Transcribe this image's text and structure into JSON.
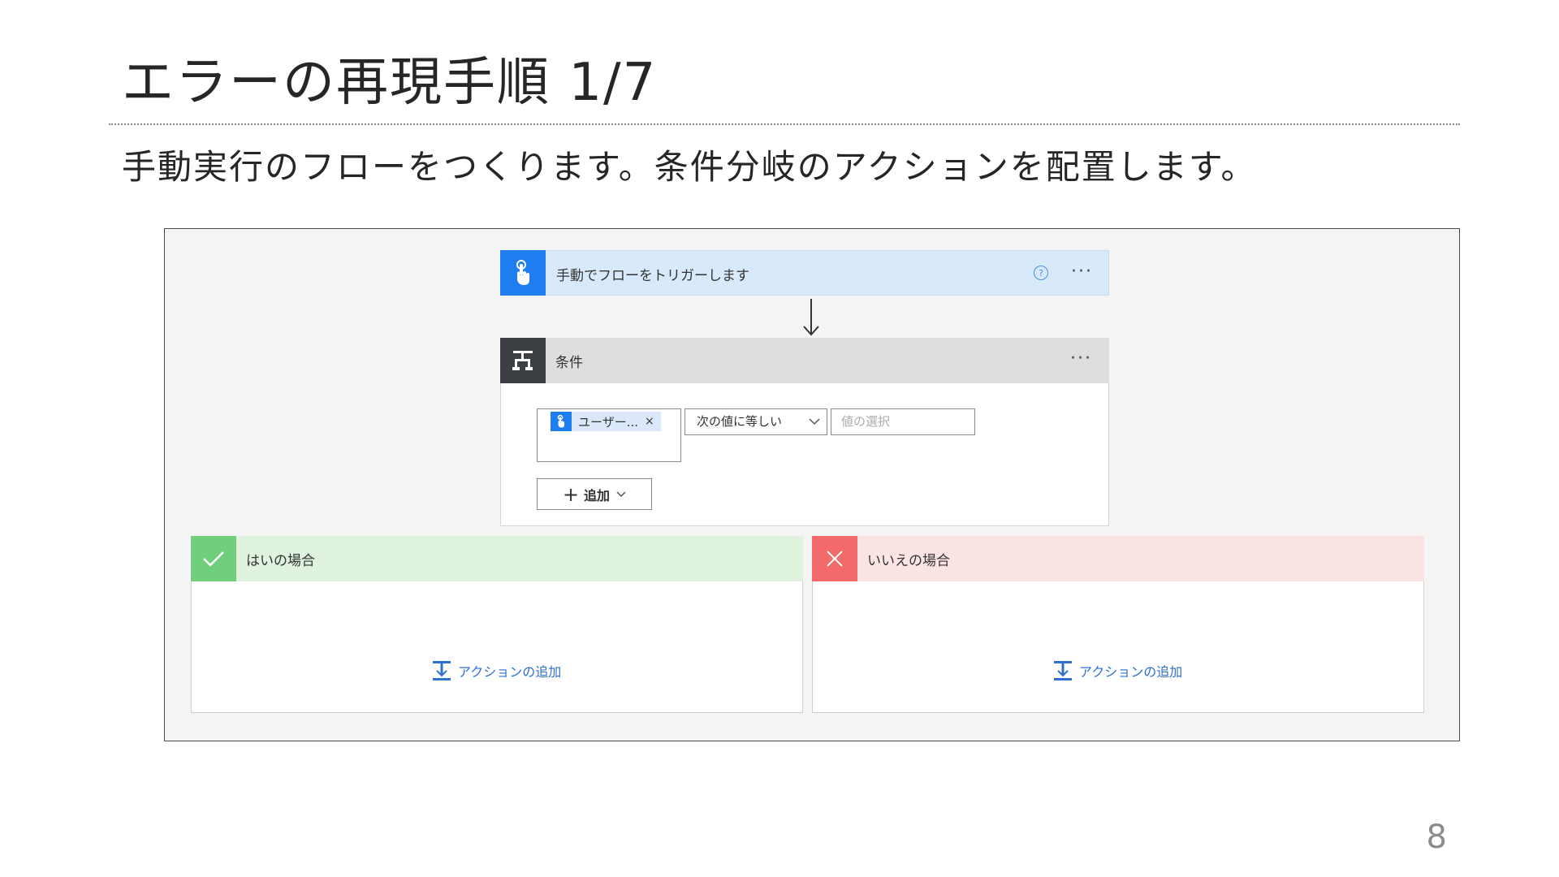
{
  "slide": {
    "title": "エラーの再現手順 1/7",
    "description": "手動実行のフローをつくります。条件分岐のアクションを配置します。",
    "page_number": "8"
  },
  "flow": {
    "trigger": {
      "title": "手動でフローをトリガーします",
      "help_icon": "?",
      "more_icon": "···",
      "icon": "hand-touch-icon",
      "color": "#1e7ef0"
    },
    "condition": {
      "title": "条件",
      "more_icon": "···",
      "icon": "condition-icon",
      "left_token": "ユーザー...",
      "token_close": "×",
      "operator": "次の値に等しい",
      "value_placeholder": "値の選択",
      "add_button": "追加"
    },
    "branches": {
      "yes": {
        "title": "はいの場合",
        "add_action": "アクションの追加",
        "icon": "check-icon",
        "color": "#6fcf7d"
      },
      "no": {
        "title": "いいえの場合",
        "add_action": "アクションの追加",
        "icon": "close-icon",
        "color": "#f26a6a"
      }
    }
  }
}
